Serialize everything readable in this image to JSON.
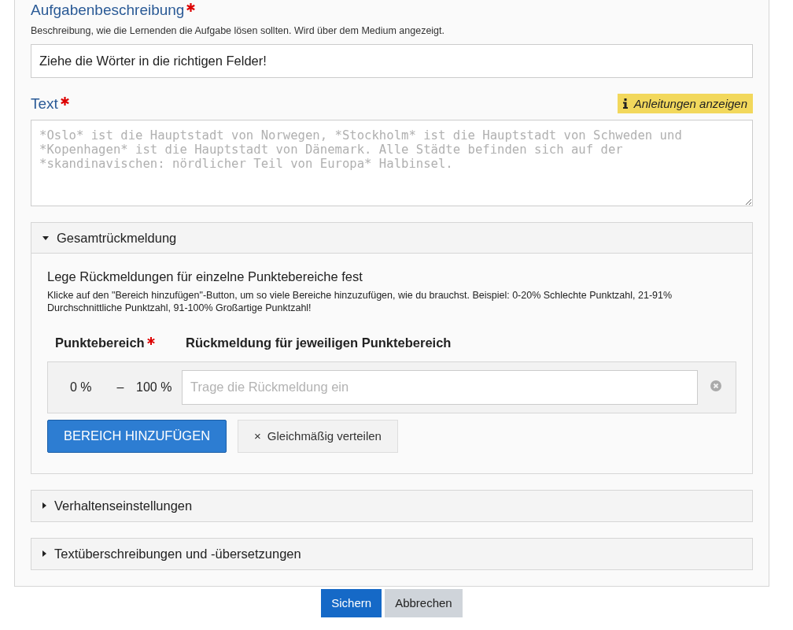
{
  "task_description": {
    "label": "Aufgabenbeschreibung",
    "required": true,
    "hint": "Beschreibung, wie die Lernenden die Aufgabe lösen sollten. Wird über dem Medium angezeigt.",
    "value": "Ziehe die Wörter in die richtigen Felder!"
  },
  "text": {
    "label": "Text",
    "required": true,
    "instructions_button": "Anleitungen anzeigen",
    "placeholder": "*Oslo* ist die Hauptstadt von Norwegen, *Stockholm* ist die Hauptstadt von Schweden und *Kopenhagen* ist die Hauptstadt von Dänemark. Alle Städte befinden sich auf der *skandinavischen: nördlicher Teil von Europa* Halbinsel."
  },
  "sections": [
    {
      "title": "Gesamtrückmeldung",
      "expanded": true,
      "heading": "Lege Rückmeldungen für einzelne Punktebereiche fest",
      "description": "Klicke auf den \"Bereich hinzufügen\"-Button, um so viele Bereiche hinzuzufügen, wie du brauchst. Beispiel: 0-20% Schlechte Punktzahl, 21-91% Durchschnittliche Punktzahl, 91-100% Großartige Punktzahl!",
      "columns": [
        {
          "label": "Punktebereich",
          "required": true
        },
        {
          "label": "Rückmeldung für jeweiligen Punktebereich",
          "required": false
        }
      ],
      "ranges": [
        {
          "from": "0 %",
          "separator": "–",
          "to": "100 %",
          "placeholder": "Trage die Rückmeldung ein"
        }
      ],
      "add_button": "BEREICH HINZUFÜGEN",
      "distribute_button": {
        "icon": "×",
        "label": "Gleichmäßig verteilen"
      }
    },
    {
      "title": "Verhaltenseinstellungen",
      "expanded": false
    },
    {
      "title": "Textüberschreibungen und -übersetzungen",
      "expanded": false
    }
  ],
  "buttons": [
    {
      "label": "Sichern",
      "kind": "primary"
    },
    {
      "label": "Abbrechen",
      "kind": "secondary"
    }
  ]
}
